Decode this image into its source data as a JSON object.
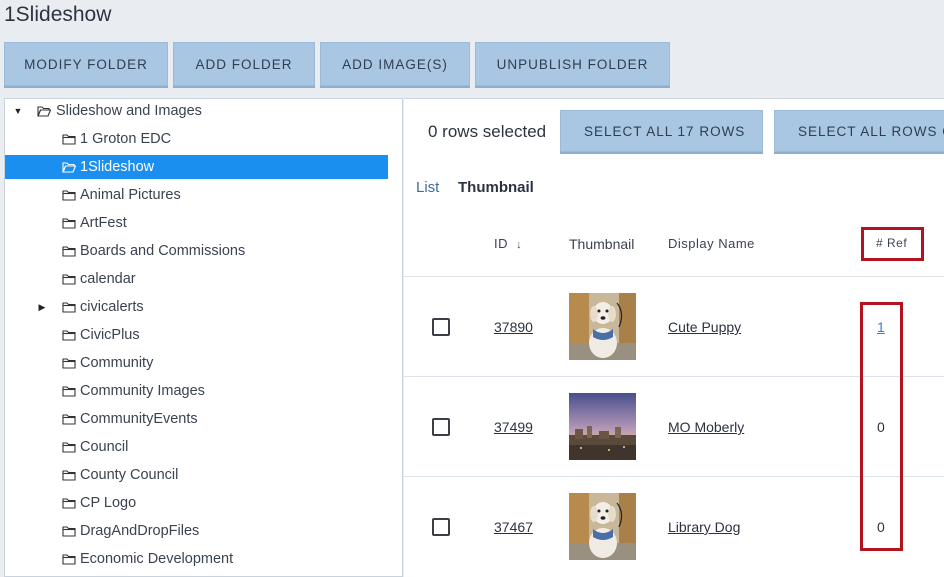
{
  "page": {
    "title": "1Slideshow"
  },
  "toolbar": {
    "modify_folder": "MODIFY FOLDER",
    "add_folder": "ADD FOLDER",
    "add_images": "ADD IMAGE(S)",
    "unpublish_folder": "UNPUBLISH FOLDER"
  },
  "tree": {
    "root": {
      "label": "Slideshow and Images",
      "expanded": true
    },
    "items": [
      {
        "label": "1 Groton EDC",
        "selected": false,
        "has_children": false
      },
      {
        "label": "1Slideshow",
        "selected": true,
        "has_children": false
      },
      {
        "label": "Animal Pictures",
        "selected": false,
        "has_children": false
      },
      {
        "label": "ArtFest",
        "selected": false,
        "has_children": false
      },
      {
        "label": "Boards and Commissions",
        "selected": false,
        "has_children": false
      },
      {
        "label": "calendar",
        "selected": false,
        "has_children": false
      },
      {
        "label": "civicalerts",
        "selected": false,
        "has_children": true
      },
      {
        "label": "CivicPlus",
        "selected": false,
        "has_children": false
      },
      {
        "label": "Community",
        "selected": false,
        "has_children": false
      },
      {
        "label": "Community Images",
        "selected": false,
        "has_children": false
      },
      {
        "label": "CommunityEvents",
        "selected": false,
        "has_children": false
      },
      {
        "label": "Council",
        "selected": false,
        "has_children": false
      },
      {
        "label": "County Council",
        "selected": false,
        "has_children": false
      },
      {
        "label": "CP Logo",
        "selected": false,
        "has_children": false
      },
      {
        "label": "DragAndDropFiles",
        "selected": false,
        "has_children": false
      },
      {
        "label": "Economic Development",
        "selected": false,
        "has_children": false
      }
    ]
  },
  "selection": {
    "status": "0 rows selected",
    "select_all_label": "SELECT ALL 17 ROWS",
    "select_all_other_label": "SELECT ALL ROWS ON"
  },
  "view": {
    "list_label": "List",
    "thumbnail_label": "Thumbnail"
  },
  "table": {
    "columns": {
      "id": "ID",
      "thumbnail": "Thumbnail",
      "display_name": "Display Name",
      "ref": "# Ref"
    },
    "sort_icon": "arrow-down-icon",
    "rows": [
      {
        "id": "37890",
        "display_name": "Cute Puppy",
        "ref": "1",
        "ref_is_link": true,
        "image": "puppy"
      },
      {
        "id": "37499",
        "display_name": "MO Moberly",
        "ref": "0",
        "ref_is_link": false,
        "image": "skyline"
      },
      {
        "id": "37467",
        "display_name": "Library Dog",
        "ref": "0",
        "ref_is_link": false,
        "image": "puppy"
      }
    ]
  },
  "colors": {
    "button_bg": "#a9c6e3",
    "selected_bg": "#1b8ff0",
    "highlight_border": "#b4121f",
    "link": "#2f7fd6"
  }
}
